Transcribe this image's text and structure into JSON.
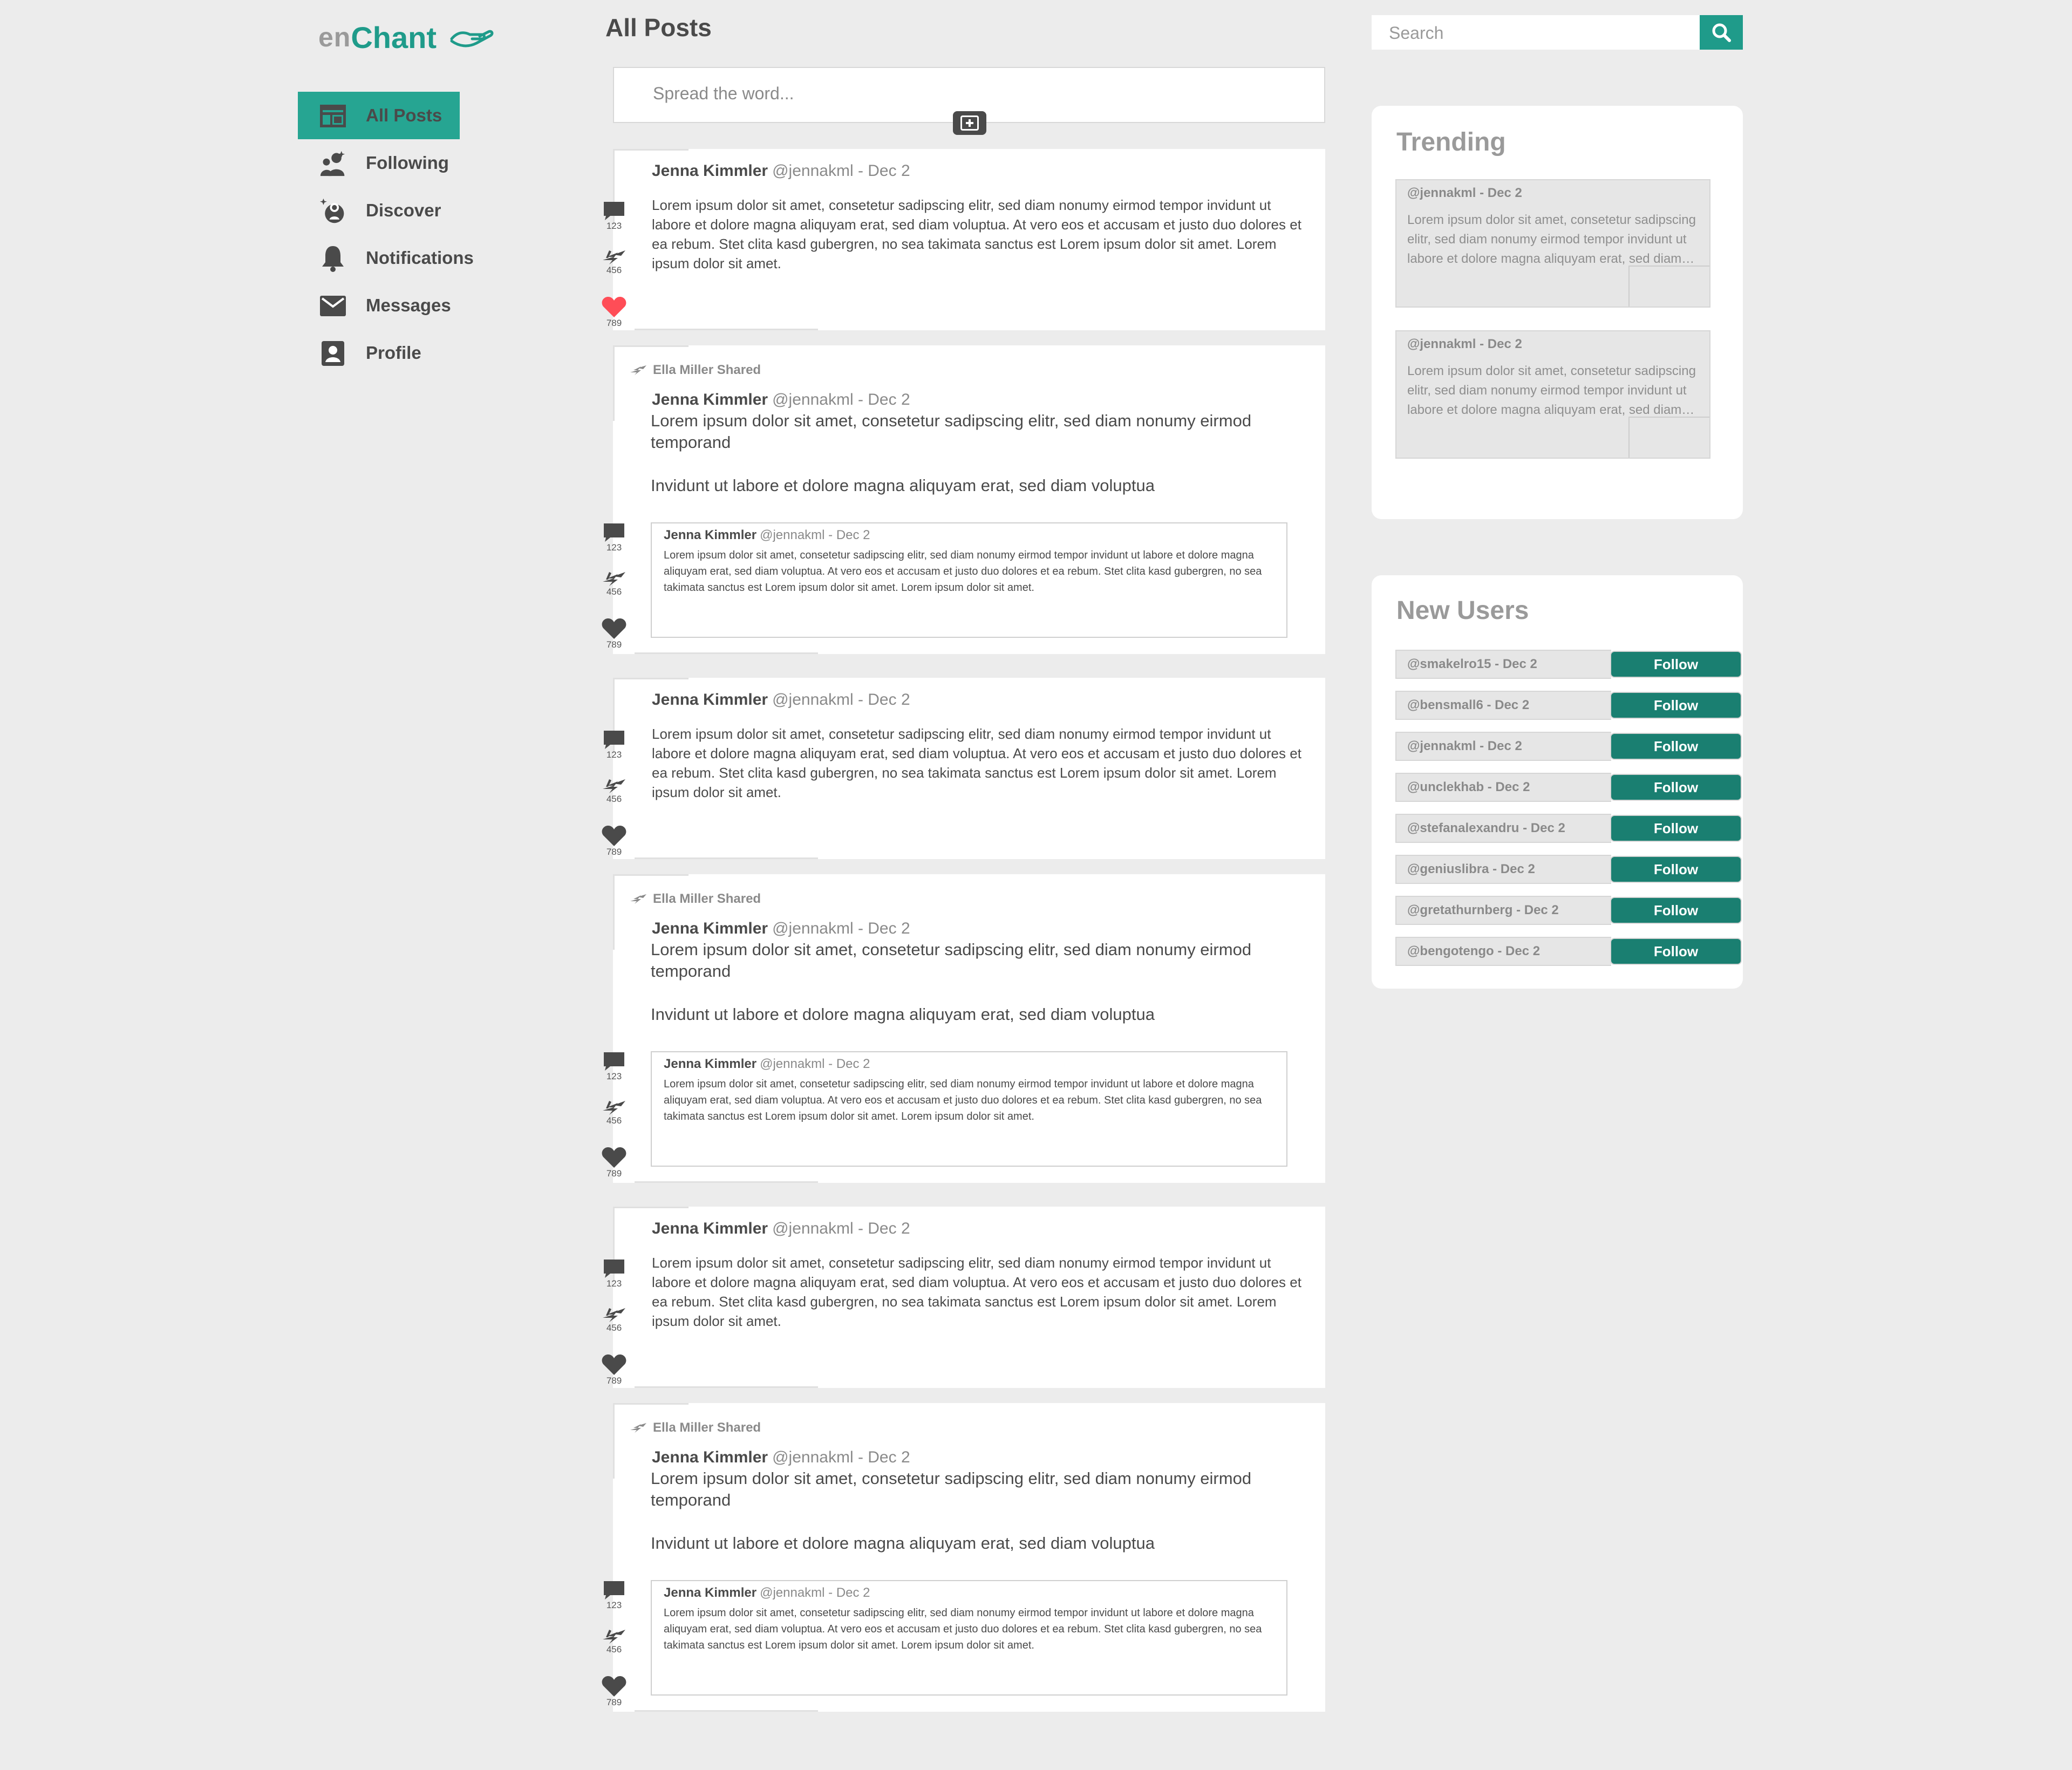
{
  "logo": {
    "prefix": "en",
    "name": "Chant",
    "icon": "hand-icon"
  },
  "nav": {
    "items": [
      {
        "label": "All Posts",
        "icon": "dashboard-icon",
        "active": true
      },
      {
        "label": "Following",
        "icon": "users-icon"
      },
      {
        "label": "Discover",
        "icon": "discover-icon"
      },
      {
        "label": "Notifications",
        "icon": "bell-icon"
      },
      {
        "label": "Messages",
        "icon": "mail-icon"
      },
      {
        "label": "Profile",
        "icon": "profile-icon"
      }
    ]
  },
  "page": {
    "title": "All Posts"
  },
  "composer": {
    "placeholder": "Spread the word...",
    "add_icon": "add-post-icon"
  },
  "search": {
    "placeholder": "Search",
    "icon": "search-icon"
  },
  "posts": [
    {
      "type": "post",
      "author": "Jenna Kimmler",
      "meta": "@jennakml - Dec 2",
      "text": "Lorem ipsum dolor sit amet, consetetur sadipscing elitr, sed diam nonumy eirmod tempor invidunt ut labore et dolore magna aliquyam erat, sed diam voluptua. At vero eos et accusam et justo duo dolores et ea rebum. Stet clita kasd gubergren, no sea takimata sanctus est Lorem ipsum dolor sit amet. Lorem ipsum dolor sit amet.",
      "comments": "123",
      "shares": "456",
      "likes": "789",
      "liked": true
    },
    {
      "type": "share",
      "shared_by": "Ella Miller Shared",
      "author": "Jenna Kimmler",
      "meta": "@jennakml - Dec 2",
      "text1": "Lorem ipsum dolor sit amet, consetetur sadipscing elitr, sed diam nonumy eirmod temporand",
      "text2": "Invidunt ut labore et dolore magna aliquyam erat, sed diam voluptua",
      "quote": {
        "author": "Jenna Kimmler",
        "meta": "@jennakml - Dec 2",
        "text": "Lorem ipsum dolor sit amet, consetetur sadipscing elitr, sed diam nonumy eirmod tempor invidunt ut labore et dolore magna aliquyam erat, sed diam voluptua. At vero eos et accusam et justo duo dolores et ea rebum. Stet clita kasd gubergren, no sea takimata sanctus est Lorem ipsum dolor sit amet. Lorem ipsum dolor sit amet."
      },
      "comments": "123",
      "shares": "456",
      "likes": "789",
      "liked": false
    },
    {
      "type": "post",
      "author": "Jenna Kimmler",
      "meta": "@jennakml - Dec 2",
      "text": "Lorem ipsum dolor sit amet, consetetur sadipscing elitr, sed diam nonumy eirmod tempor invidunt ut labore et dolore magna aliquyam erat, sed diam voluptua. At vero eos et accusam et justo duo dolores et ea rebum. Stet clita kasd gubergren, no sea takimata sanctus est Lorem ipsum dolor sit amet. Lorem ipsum dolor sit amet.",
      "comments": "123",
      "shares": "456",
      "likes": "789",
      "liked": false
    },
    {
      "type": "share",
      "shared_by": "Ella Miller Shared",
      "author": "Jenna Kimmler",
      "meta": "@jennakml - Dec 2",
      "text1": "Lorem ipsum dolor sit amet, consetetur sadipscing elitr, sed diam nonumy eirmod temporand",
      "text2": "Invidunt ut labore et dolore magna aliquyam erat, sed diam voluptua",
      "quote": {
        "author": "Jenna Kimmler",
        "meta": "@jennakml - Dec 2",
        "text": "Lorem ipsum dolor sit amet, consetetur sadipscing elitr, sed diam nonumy eirmod tempor invidunt ut labore et dolore magna aliquyam erat, sed diam voluptua. At vero eos et accusam et justo duo dolores et ea rebum. Stet clita kasd gubergren, no sea takimata sanctus est Lorem ipsum dolor sit amet. Lorem ipsum dolor sit amet."
      },
      "comments": "123",
      "shares": "456",
      "likes": "789",
      "liked": false
    },
    {
      "type": "post",
      "author": "Jenna Kimmler",
      "meta": "@jennakml - Dec 2",
      "text": "Lorem ipsum dolor sit amet, consetetur sadipscing elitr, sed diam nonumy eirmod tempor invidunt ut labore et dolore magna aliquyam erat, sed diam voluptua. At vero eos et accusam et justo duo dolores et ea rebum. Stet clita kasd gubergren, no sea takimata sanctus est Lorem ipsum dolor sit amet. Lorem ipsum dolor sit amet.",
      "comments": "123",
      "shares": "456",
      "likes": "789",
      "liked": false
    },
    {
      "type": "share",
      "shared_by": "Ella Miller Shared",
      "author": "Jenna Kimmler",
      "meta": "@jennakml - Dec 2",
      "text1": "Lorem ipsum dolor sit amet, consetetur sadipscing elitr, sed diam nonumy eirmod temporand",
      "text2": "Invidunt ut labore et dolore magna aliquyam erat, sed diam voluptua",
      "quote": {
        "author": "Jenna Kimmler",
        "meta": "@jennakml - Dec 2",
        "text": "Lorem ipsum dolor sit amet, consetetur sadipscing elitr, sed diam nonumy eirmod tempor invidunt ut labore et dolore magna aliquyam erat, sed diam voluptua. At vero eos et accusam et justo duo dolores et ea rebum. Stet clita kasd gubergren, no sea takimata sanctus est Lorem ipsum dolor sit amet. Lorem ipsum dolor sit amet."
      },
      "comments": "123",
      "shares": "456",
      "likes": "789",
      "liked": false
    }
  ],
  "trending": {
    "title": "Trending",
    "items": [
      {
        "handle": "@jennakml - Dec 2",
        "text": "Lorem ipsum dolor sit amet, consetetur sadipscing elitr, sed diam nonumy eirmod tempor invidunt ut labore et dolore magna aliquyam erat, sed diam…"
      },
      {
        "handle": "@jennakml - Dec 2",
        "text": "Lorem ipsum dolor sit amet, consetetur sadipscing elitr, sed diam nonumy eirmod tempor invidunt ut labore et dolore magna aliquyam erat, sed diam…"
      }
    ]
  },
  "new_users": {
    "title": "New Users",
    "follow_label": "Follow",
    "users": [
      "@smakelro15 - Dec 2",
      "@bensmall6 - Dec 2",
      "@jennakml - Dec 2",
      "@unclekhab - Dec 2",
      "@stefanalexandru - Dec 2",
      "@geniuslibra - Dec 2",
      "@gretathurnberg - Dec 2",
      "@bengotengo - Dec 2"
    ]
  },
  "colors": {
    "accent": "#1f9b8a",
    "follow": "#1a7f71",
    "like": "#ff4d57",
    "text": "#4a4a4a",
    "background": "#ececec"
  }
}
